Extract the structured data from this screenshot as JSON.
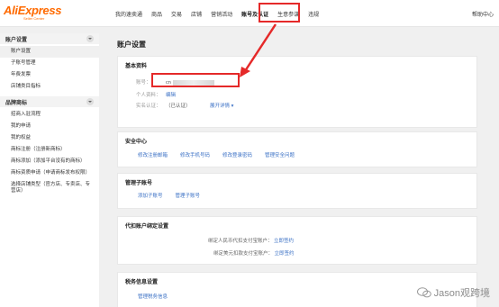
{
  "header": {
    "logo": "AliExpress",
    "logo_sub": "Seller Center",
    "nav": [
      {
        "label": "我的速卖通"
      },
      {
        "label": "商品"
      },
      {
        "label": "交易"
      },
      {
        "label": "店铺"
      },
      {
        "label": "营销活动"
      },
      {
        "label": "账号及认证"
      },
      {
        "label": "生意参谋"
      },
      {
        "label": "违规"
      }
    ],
    "help": "帮助中心"
  },
  "sidebar": {
    "groups": [
      {
        "title": "账户设置",
        "items": [
          {
            "label": "账户设置"
          },
          {
            "label": "子账号管理"
          },
          {
            "label": "年费发票"
          },
          {
            "label": "店铺类目指标"
          }
        ]
      },
      {
        "title": "品牌商标",
        "items": [
          {
            "label": "招商入驻流程"
          },
          {
            "label": "我的申请"
          },
          {
            "label": "我的权益"
          },
          {
            "label": "商标注册（注册新商标）"
          },
          {
            "label": "商标添加（添加平台没有的商标）"
          },
          {
            "label": "商标资质申请（申请商标发布权限）"
          },
          {
            "label": "选择店铺类型（官方店、专卖店、专营店）"
          }
        ]
      }
    ]
  },
  "main": {
    "page_title": "账户设置",
    "basic": {
      "title": "基本资料",
      "account_label": "账号：",
      "account_value": "cn",
      "profile_label": "个人资料：",
      "profile_link": "编辑",
      "verify_label": "实名认证：",
      "verify_value": "（已认证）",
      "verify_link": "展开详情"
    },
    "security": {
      "title": "安全中心",
      "links": [
        "修改注册邮箱",
        "修改手机号码",
        "修改登录密码",
        "管理安全问题"
      ]
    },
    "sub_accounts": {
      "title": "管理子账号",
      "links": [
        "添加子账号",
        "管理子账号"
      ]
    },
    "binding": {
      "title": "代扣账户绑定设置",
      "rmb_label": "绑定人民币代扣支付宝账户：",
      "rmb_link": "立即签约",
      "usd_label": "绑定美元扣款支付宝账户：",
      "usd_link": "立即签约"
    },
    "tax": {
      "title": "税务信息设置",
      "link": "管理税务信息"
    }
  },
  "watermark": {
    "text": "Jason观跨境"
  },
  "colors": {
    "accent": "#ff6a00",
    "link": "#3a70c5",
    "highlight": "#e52929"
  }
}
